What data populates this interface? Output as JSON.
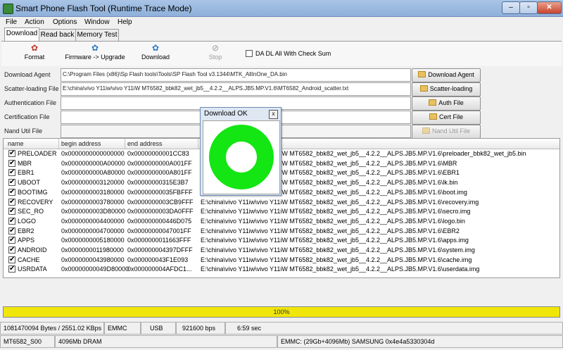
{
  "window": {
    "title": "Smart Phone Flash Tool (Runtime Trace Mode)",
    "minimize": "–",
    "maximize": "▫",
    "close": "✕"
  },
  "menu": [
    "File",
    "Action",
    "Options",
    "Window",
    "Help"
  ],
  "tabs": [
    "Download",
    "Read back",
    "Memory Test"
  ],
  "toolbar": {
    "format": "Format",
    "firmware_upgrade": "Firmware -> Upgrade",
    "download": "Download",
    "stop": "Stop",
    "da_dl_checksum": "DA DL All With Check Sum"
  },
  "fields": {
    "download_agent": {
      "label": "Download Agent",
      "value": "C:\\Program Files (x86)\\Sp Flash tools\\Tools\\SP Flash Tool v3.1344\\MTK_AllInOne_DA.bin"
    },
    "scatter": {
      "label": "Scatter-loading File",
      "value": "E:\\china\\vivo Y11iw\\vivo Y11iW MT6582_bbk82_wet_jb5__4.2.2__ALPS.JB5.MP.V1.6\\MT6582_Android_scatter.txt"
    },
    "authentication": {
      "label": "Authentication File",
      "value": ""
    },
    "certification": {
      "label": "Certification File",
      "value": ""
    },
    "nand_util": {
      "label": "Nand Util File",
      "value": ""
    }
  },
  "side_buttons": {
    "download_agent": "Download Agent",
    "scatter_loading": "Scatter-loading",
    "auth_file": "Auth File",
    "cert_file": "Cert File",
    "nand_util_file": "Nand Util File"
  },
  "table": {
    "columns": [
      "name",
      "begin address",
      "end address",
      ""
    ],
    "rows": [
      {
        "name": "PRELOADER",
        "begin": "0x0000000000000000",
        "end": "0x00000000001CC83",
        "path": "E:\\china\\vivo Y11iw\\vivo Y11iW MT6582_bbk82_wet_jb5__4.2.2__ALPS.JB5.MP.V1.6\\preloader_bbk82_wet_jb5.bin"
      },
      {
        "name": "MBR",
        "begin": "0x0000000000A00000",
        "end": "0x0000000000A001FF",
        "path": "E:\\china\\vivo Y11iw\\vivo Y11iW MT6582_bbk82_wet_jb5__4.2.2__ALPS.JB5.MP.V1.6\\MBR"
      },
      {
        "name": "EBR1",
        "begin": "0x0000000000A80000",
        "end": "0x0000000000A801FF",
        "path": "E:\\china\\vivo Y11iw\\vivo Y11iW MT6582_bbk82_wet_jb5__4.2.2__ALPS.JB5.MP.V1.6\\EBR1"
      },
      {
        "name": "UBOOT",
        "begin": "0x0000000003120000",
        "end": "0x00000000315E3B7",
        "path": "E:\\china\\vivo Y11iw\\vivo Y11iW MT6582_bbk82_wet_jb5__4.2.2__ALPS.JB5.MP.V1.6\\lk.bin"
      },
      {
        "name": "BOOTIMG",
        "begin": "0x0000000003180000",
        "end": "0x00000000035FBFFF",
        "path": "E:\\china\\vivo Y11iw\\vivo Y11iW MT6582_bbk82_wet_jb5__4.2.2__ALPS.JB5.MP.V1.6\\boot.img"
      },
      {
        "name": "RECOVERY",
        "begin": "0x0000000003780000",
        "end": "0x0000000003CB9FFF",
        "path": "E:\\china\\vivo Y11iw\\vivo Y11iW MT6582_bbk82_wet_jb5__4.2.2__ALPS.JB5.MP.V1.6\\recovery.img"
      },
      {
        "name": "SEC_RO",
        "begin": "0x0000000003D80000",
        "end": "0x0000000003DA0FFF",
        "path": "E:\\china\\vivo Y11iw\\vivo Y11iW MT6582_bbk82_wet_jb5__4.2.2__ALPS.JB5.MP.V1.6\\secro.img"
      },
      {
        "name": "LOGO",
        "begin": "0x0000000004400000",
        "end": "0x000000000446D075",
        "path": "E:\\china\\vivo Y11iw\\vivo Y11iW MT6582_bbk82_wet_jb5__4.2.2__ALPS.JB5.MP.V1.6\\logo.bin"
      },
      {
        "name": "EBR2",
        "begin": "0x0000000004700000",
        "end": "0x00000000047001FF",
        "path": "E:\\china\\vivo Y11iw\\vivo Y11iW MT6582_bbk82_wet_jb5__4.2.2__ALPS.JB5.MP.V1.6\\EBR2"
      },
      {
        "name": "APPS",
        "begin": "0x0000000005180000",
        "end": "0x0000000011663FFF",
        "path": "E:\\china\\vivo Y11iw\\vivo Y11iW MT6582_bbk82_wet_jb5__4.2.2__ALPS.JB5.MP.V1.6\\apps.img"
      },
      {
        "name": "ANDROID",
        "begin": "0x0000000011980000",
        "end": "0x000000004397DFFF",
        "path": "E:\\china\\vivo Y11iw\\vivo Y11iW MT6582_bbk82_wet_jb5__4.2.2__ALPS.JB5.MP.V1.6\\system.img"
      },
      {
        "name": "CACHE",
        "begin": "0x0000000043980000",
        "end": "0x000000043F1E093",
        "path": "E:\\china\\vivo Y11iw\\vivo Y11iW MT6582_bbk82_wet_jb5__4.2.2__ALPS.JB5.MP.V1.6\\cache.img"
      },
      {
        "name": "USRDATA",
        "begin": "0x00000000049D80000",
        "end": "0x000000004AFDC1...",
        "path": "E:\\china\\vivo Y11iw\\vivo Y11iW MT6582_bbk82_wet_jb5__4.2.2__ALPS.JB5.MP.V1.6\\userdata.img"
      }
    ]
  },
  "progress": {
    "text": "100%",
    "value": 100,
    "color": "#f0e60a"
  },
  "status1": {
    "bytes": "1081470094 Bytes / 2551.02 KBps",
    "storage": "EMMC",
    "port": "USB",
    "baud": "921600 bps",
    "time": "6:59 sec"
  },
  "status2": {
    "chip": "MT6582_S00",
    "dram": "4096Mb DRAM",
    "emmc": "EMMC: (29Gb+4096Mb) SAMSUNG 0x4e4a5330304d"
  },
  "dialog": {
    "title": "Download OK",
    "close": "x",
    "ring_color": "#13e613"
  }
}
